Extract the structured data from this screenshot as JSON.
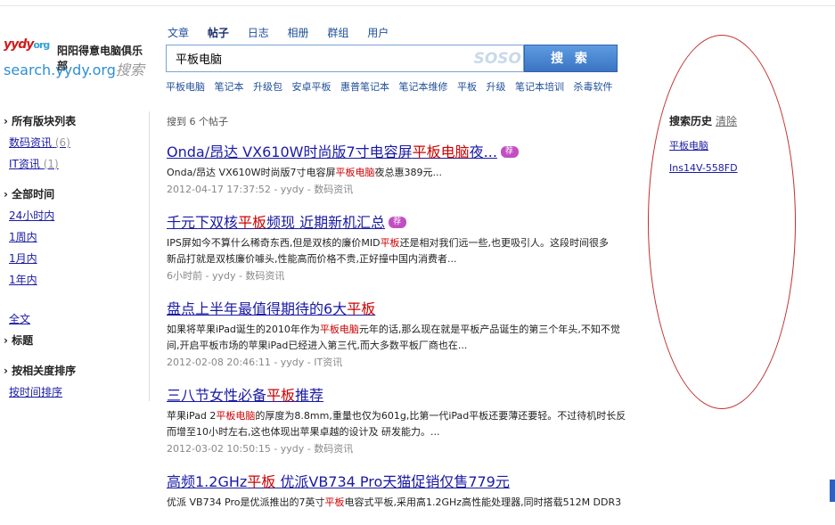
{
  "logo": {
    "mark": "yydy",
    "mark_org": "org",
    "club_name": "阳阳得意电脑俱乐部",
    "url": "search.yydy.org",
    "url_suffix": "搜索"
  },
  "tabs": [
    "文章",
    "帖子",
    "日志",
    "相册",
    "群组",
    "用户"
  ],
  "active_tab": "帖子",
  "search": {
    "value": "平板电脑",
    "brand": "SOSO",
    "button_label": "搜 索"
  },
  "suggestions": [
    "平板电脑",
    "笔记本",
    "升级包",
    "安卓平板",
    "惠普笔记本",
    "笔记本维修",
    "平板",
    "升级",
    "笔记本培训",
    "杀毒软件"
  ],
  "sidebar": {
    "boards_title": "所有版块列表",
    "boards": [
      {
        "label": "数码资讯",
        "count": "(6)"
      },
      {
        "label": "IT资讯",
        "count": "(1)"
      }
    ],
    "time_title": "全部时间",
    "times": [
      "24小时内",
      "1周内",
      "1月内",
      "1年内"
    ],
    "scope_all": "全文",
    "scope_title": "标题",
    "sort_title": "按相关度排序",
    "sort_time": "按时间排序"
  },
  "result_count": "搜到 6 个帖子",
  "results": [
    {
      "title_pre": "Onda/昂达 VX610W时尚版7寸电容屏",
      "title_hl": "平板电脑",
      "title_post": "夜...",
      "badge": true,
      "snippet_pre": "Onda/昂达 VX610W时尚版7寸电容屏",
      "snippet_hl": "平板电脑",
      "snippet_post": "夜总惠389元...",
      "meta": "2012-04-17 17:37:52 - yydy - 数码资讯"
    },
    {
      "title_pre": "千元下双核",
      "title_hl": "平板",
      "title_post": "频现 近期新机汇总",
      "badge": true,
      "snippet_pre": "IPS屏如今不算什么稀奇东西,但是双核的廉价MID",
      "snippet_hl": "平板",
      "snippet_post": "还是相对我们远一些,也更吸引人。这段时间很多",
      "snippet2": "新品打就是双核廉价噱头,性能高而价格不贵,正好撞中国内消费者...",
      "meta": "6小时前 - yydy - 数码资讯"
    },
    {
      "title_pre": "盘点上半年最值得期待的6大",
      "title_hl": "平板",
      "title_post": "",
      "badge": false,
      "snippet_pre": "如果将苹果iPad诞生的2010年作为",
      "snippet_hl": "平板电脑",
      "snippet_post": "元年的话,那么现在就是平板产品诞生的第三个年头,不知不觉",
      "snippet2": "间,开启平板市场的苹果iPad已经进入第三代,而大多数平板厂商也在...",
      "meta": "2012-02-08 20:46:11 - yydy - IT资讯"
    },
    {
      "title_pre": "三八节女性必备",
      "title_hl": "平板",
      "title_post": "推荐",
      "badge": false,
      "snippet_pre": "苹果iPad 2",
      "snippet_hl": "平板电脑",
      "snippet_post": "的厚度为8.8mm,重量也仅为601g,比第一代iPad平板还要薄还要轻。不过待机时长反",
      "snippet2": "而增至10小时左右,这也体现出苹果卓越的设计及 研发能力。...",
      "meta": "2012-03-02 10:50:15 - yydy - 数码资讯"
    },
    {
      "title_pre": "高频1.2GHz",
      "title_hl": "平板",
      "title_post": " 优派VB734 Pro天猫促销仅售779元",
      "badge": false,
      "snippet_pre": "优派 VB734 Pro是优派推出的7英寸",
      "snippet_hl": "平板",
      "snippet_post": "电容式平板,采用高1.2GHz高性能处理器,同时搭载512M DDR3",
      "meta": ""
    }
  ],
  "history": {
    "title": "搜索历史",
    "clear": "清除",
    "items": [
      "平板电脑",
      "Ins14V-558FD"
    ]
  }
}
